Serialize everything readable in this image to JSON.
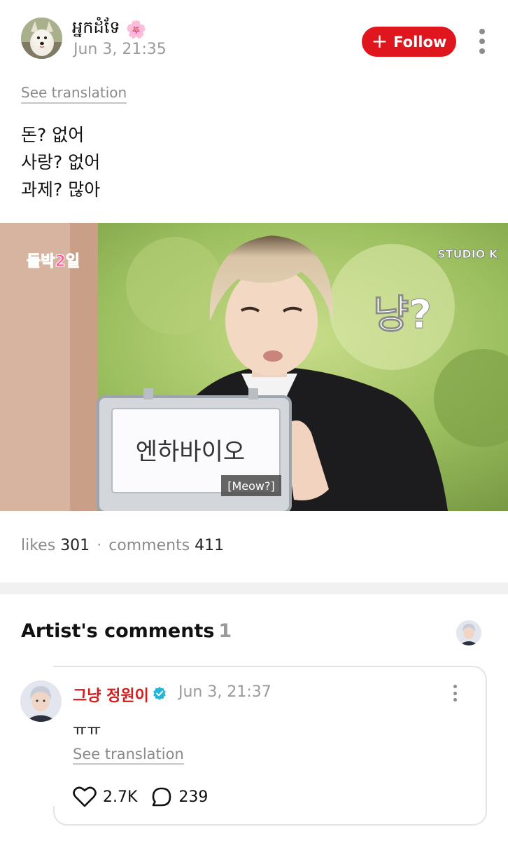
{
  "post": {
    "author": "អ្នកដំទែ",
    "author_emoji": "🌸",
    "date": "Jun 3, 21:35",
    "follow_label": "Follow",
    "follow_plus": "+",
    "see_translation": "See translation",
    "lines": [
      "돈? 없어",
      "사랑? 없어",
      "과제? 많아"
    ],
    "image": {
      "sign_text": "엔하바이오",
      "subtitle": "[Meow?]",
      "caption": "냥?",
      "logo_left": "돌박2일",
      "logo_right": "STUDIO K"
    },
    "stats": {
      "likes_label": "likes",
      "likes_count": "301",
      "separator": "·",
      "comments_label": "comments",
      "comments_count": "411"
    }
  },
  "artist_comments": {
    "title": "Artist's comments",
    "count": "1",
    "comment": {
      "author": "그냥 정원이",
      "date": "Jun 3, 21:37",
      "text": "ㅠㅠ",
      "see_translation": "See translation",
      "likes": "2.7K",
      "replies": "239"
    }
  },
  "icons": {
    "more": "more-vertical-icon",
    "heart": "heart-icon",
    "comment": "comment-bubble-icon",
    "verified": "verified-badge-icon"
  },
  "colors": {
    "accent": "#e0161f",
    "artist_name": "#d31d1d",
    "verified": "#26b4d8",
    "muted": "#8a8a8a"
  }
}
